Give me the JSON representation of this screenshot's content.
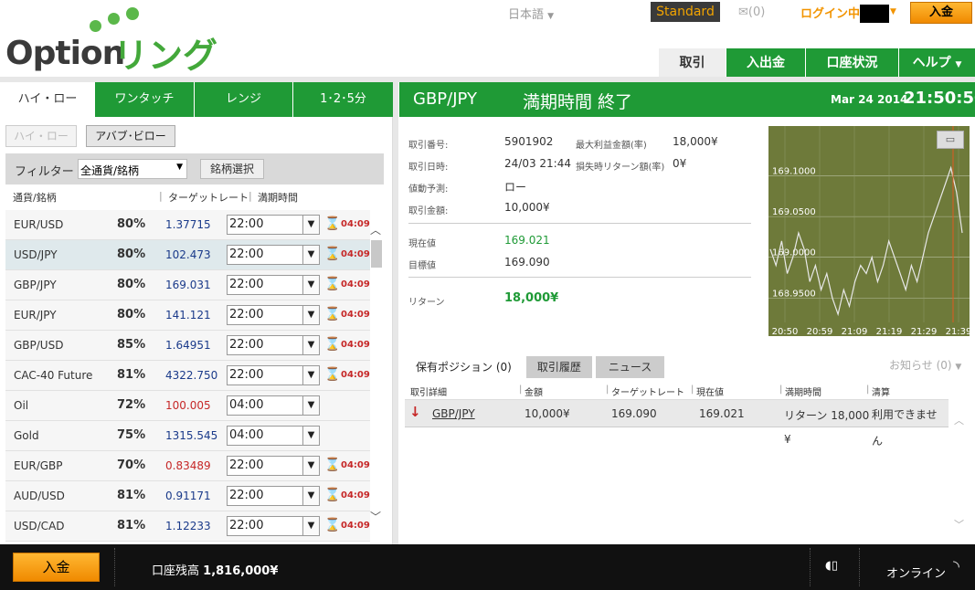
{
  "header": {
    "logo_text": "Option",
    "logo_ring": "リング",
    "language": "日本語",
    "account_type": "Standard",
    "mail": "✉(0)",
    "login": "ログイン中",
    "deposit": "入金"
  },
  "nav": {
    "tabs": [
      "取引",
      "入出金",
      "口座状況",
      "ヘルプ"
    ],
    "active": 0
  },
  "left_tabs": {
    "tabs": [
      "ハイ・ロー",
      "ワンタッチ",
      "レンジ",
      "1･2･5分"
    ],
    "active": 0
  },
  "subtabs": {
    "highlow": "ハイ・ロー",
    "above_below": "アバブ･ビロー"
  },
  "filter": {
    "label": "フィルター",
    "value": "全通貨/銘柄",
    "symbol_select": "銘柄選択"
  },
  "columns": {
    "symbol": "通貨/銘柄",
    "target_rate": "ターゲットレート",
    "expiry": "満期時間"
  },
  "assets": [
    {
      "symbol": "EUR/USD",
      "pct": "80%",
      "rate": "1.37715",
      "rate_color": "#1a3a8a",
      "time": "22:00",
      "countdown": "04:09"
    },
    {
      "symbol": "USD/JPY",
      "pct": "80%",
      "rate": "102.473",
      "rate_color": "#1a3a8a",
      "time": "22:00",
      "countdown": "04:09",
      "selected": true
    },
    {
      "symbol": "GBP/JPY",
      "pct": "80%",
      "rate": "169.031",
      "rate_color": "#1a3a8a",
      "time": "22:00",
      "countdown": "04:09"
    },
    {
      "symbol": "EUR/JPY",
      "pct": "80%",
      "rate": "141.121",
      "rate_color": "#1a3a8a",
      "time": "22:00",
      "countdown": "04:09"
    },
    {
      "symbol": "GBP/USD",
      "pct": "85%",
      "rate": "1.64951",
      "rate_color": "#1a3a8a",
      "time": "22:00",
      "countdown": "04:09"
    },
    {
      "symbol": "CAC-40 Future",
      "pct": "81%",
      "rate": "4322.750",
      "rate_color": "#1a3a8a",
      "time": "22:00",
      "countdown": "04:09"
    },
    {
      "symbol": "Oil",
      "pct": "72%",
      "rate": "100.005",
      "rate_color": "#c62828",
      "time": "04:00",
      "countdown": ""
    },
    {
      "symbol": "Gold",
      "pct": "75%",
      "rate": "1315.545",
      "rate_color": "#1a3a8a",
      "time": "04:00",
      "countdown": ""
    },
    {
      "symbol": "EUR/GBP",
      "pct": "70%",
      "rate": "0.83489",
      "rate_color": "#c62828",
      "time": "22:00",
      "countdown": "04:09"
    },
    {
      "symbol": "AUD/USD",
      "pct": "81%",
      "rate": "0.91171",
      "rate_color": "#1a3a8a",
      "time": "22:00",
      "countdown": "04:09"
    },
    {
      "symbol": "USD/CAD",
      "pct": "81%",
      "rate": "1.12233",
      "rate_color": "#1a3a8a",
      "time": "22:00",
      "countdown": "04:09"
    }
  ],
  "trade": {
    "pair": "GBP/JPY",
    "status": "満期時間 終了",
    "date": "Mar 24 2014",
    "time": "21:50:50"
  },
  "details": {
    "trade_no_label": "取引番号:",
    "trade_no": "5901902",
    "max_profit_label": "最大利益金額(率)",
    "max_profit": "18,000¥",
    "trade_date_label": "取引日時:",
    "trade_date": "24/03 21:44",
    "loss_label": "損失時リターン額(率)",
    "loss": "0¥",
    "direction_label": "値動予測:",
    "direction": "ロー",
    "amount_label": "取引金額:",
    "amount": "10,000¥",
    "current_label": "現在値",
    "current": "169.021",
    "target_label": "目標値",
    "target": "169.090",
    "return_label": "リターン",
    "return": "18,000¥"
  },
  "chart_data": {
    "type": "line",
    "x": [
      "20:50",
      "20:59",
      "21:09",
      "21:19",
      "21:29",
      "21:39"
    ],
    "y_ticks": [
      "169.1000",
      "169.0500",
      "169.0000",
      "168.9500"
    ],
    "ylim": [
      168.92,
      169.15
    ],
    "series": [
      {
        "values": [
          169.01,
          168.99,
          169.02,
          168.98,
          169.0,
          169.03,
          169.01,
          168.97,
          168.99,
          168.96,
          168.98,
          168.95,
          168.93,
          168.96,
          168.94,
          168.97,
          168.99,
          168.98,
          169.0,
          168.97,
          168.99,
          169.02,
          169.0,
          168.98,
          168.96,
          168.99,
          168.97,
          169.0,
          169.03,
          169.05,
          169.07,
          169.09,
          169.11,
          169.08,
          169.03
        ]
      }
    ],
    "background": "#6e7a3a"
  },
  "positions": {
    "tabs": [
      "保有ポジション (0)",
      "取引履歴",
      "ニュース"
    ],
    "notice": "お知らせ (0)",
    "columns": [
      "取引詳細",
      "金額",
      "ターゲットレート",
      "現在値",
      "満期時間",
      "清算"
    ],
    "row": {
      "pair": "GBP/JPY",
      "amount": "10,000¥",
      "target": "169.090",
      "current": "169.021",
      "expiry": "リターン 18,000",
      "expiry2": "¥",
      "settle": "利用できませ",
      "settle2": "ん"
    }
  },
  "footer": {
    "deposit": "入金",
    "balance_label": "口座残高",
    "balance": "1,816,000¥",
    "status": "オンライン"
  }
}
